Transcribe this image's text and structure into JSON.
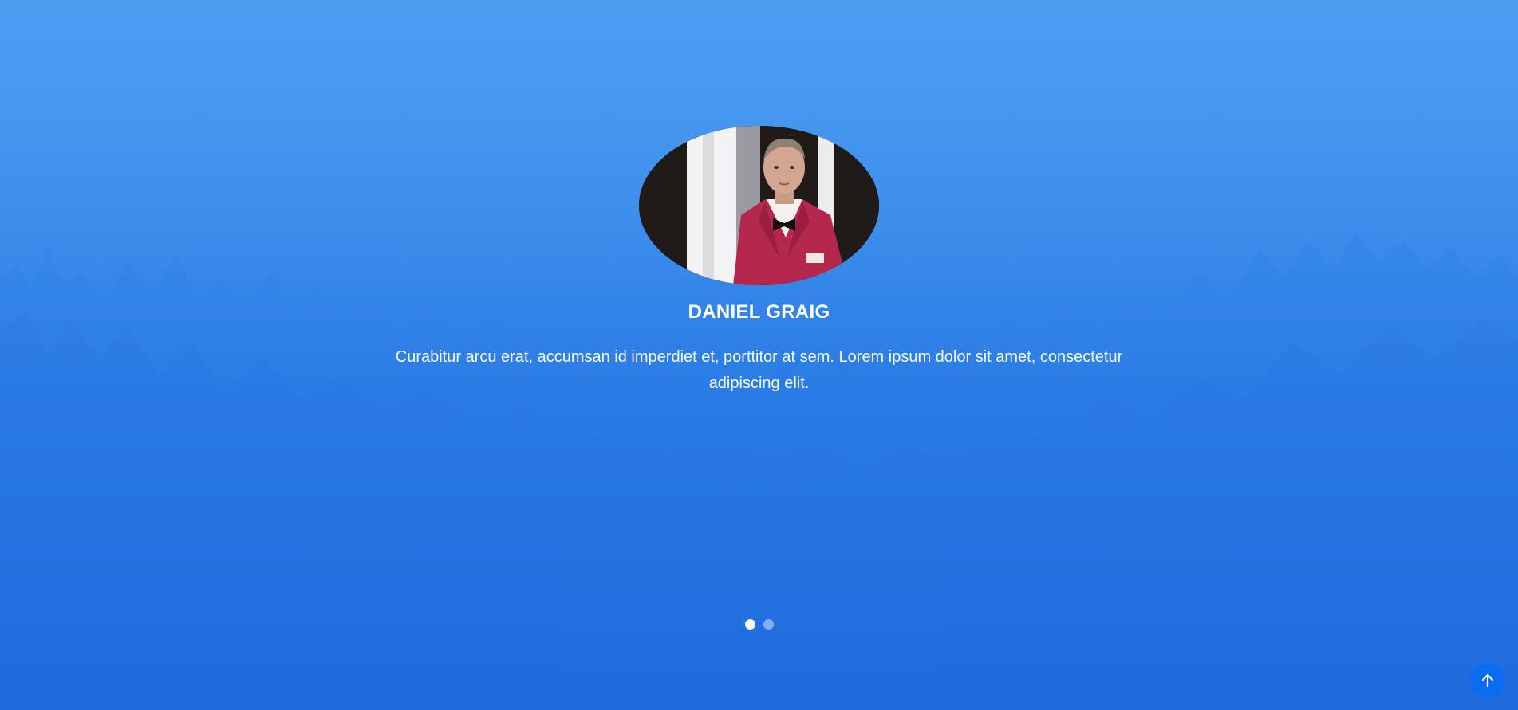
{
  "testimonial": {
    "name": "DANIEL GRAIG",
    "quote": "Curabitur arcu erat, accumsan id imperdiet et, porttitor at sem. Lorem ipsum dolor sit amet, consectetur adipiscing elit.",
    "avatar_alt": "Daniel Graig portrait"
  },
  "carousel": {
    "slide_count": 2,
    "active_index": 0
  },
  "scroll_top": {
    "icon": "arrow-up-icon"
  },
  "colors": {
    "background_top": "#4d9ef3",
    "background_bottom": "#1c69dc",
    "accent": "#0a6cf0",
    "text": "#ffffff"
  }
}
